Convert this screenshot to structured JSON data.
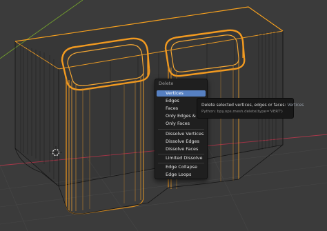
{
  "menu": {
    "title": "Delete",
    "items": [
      {
        "label": "Vertices",
        "active": true
      },
      {
        "label": "Edges"
      },
      {
        "label": "Faces"
      },
      {
        "label": "Only Edges & Faces"
      },
      {
        "label": "Only Faces"
      },
      {
        "label": "Dissolve Vertices"
      },
      {
        "label": "Dissolve Edges"
      },
      {
        "label": "Dissolve Faces"
      },
      {
        "label": "Limited Dissolve"
      },
      {
        "label": "Edge Collapse"
      },
      {
        "label": "Edge Loops"
      }
    ]
  },
  "tooltip": {
    "description": "Delete selected vertices, edges or faces:",
    "keyword": "Vertices",
    "python": "Python: bpy.ops.mesh.delete(type='VERT')"
  },
  "colors": {
    "background": "#3b3b3b",
    "selection": "#ff9f1a",
    "wire": "#111111",
    "accent": "#5680c2",
    "x_axis": "#a8384a",
    "y_axis": "#6f9a2e"
  },
  "icons": {
    "cursor": "3d-cursor-icon"
  }
}
